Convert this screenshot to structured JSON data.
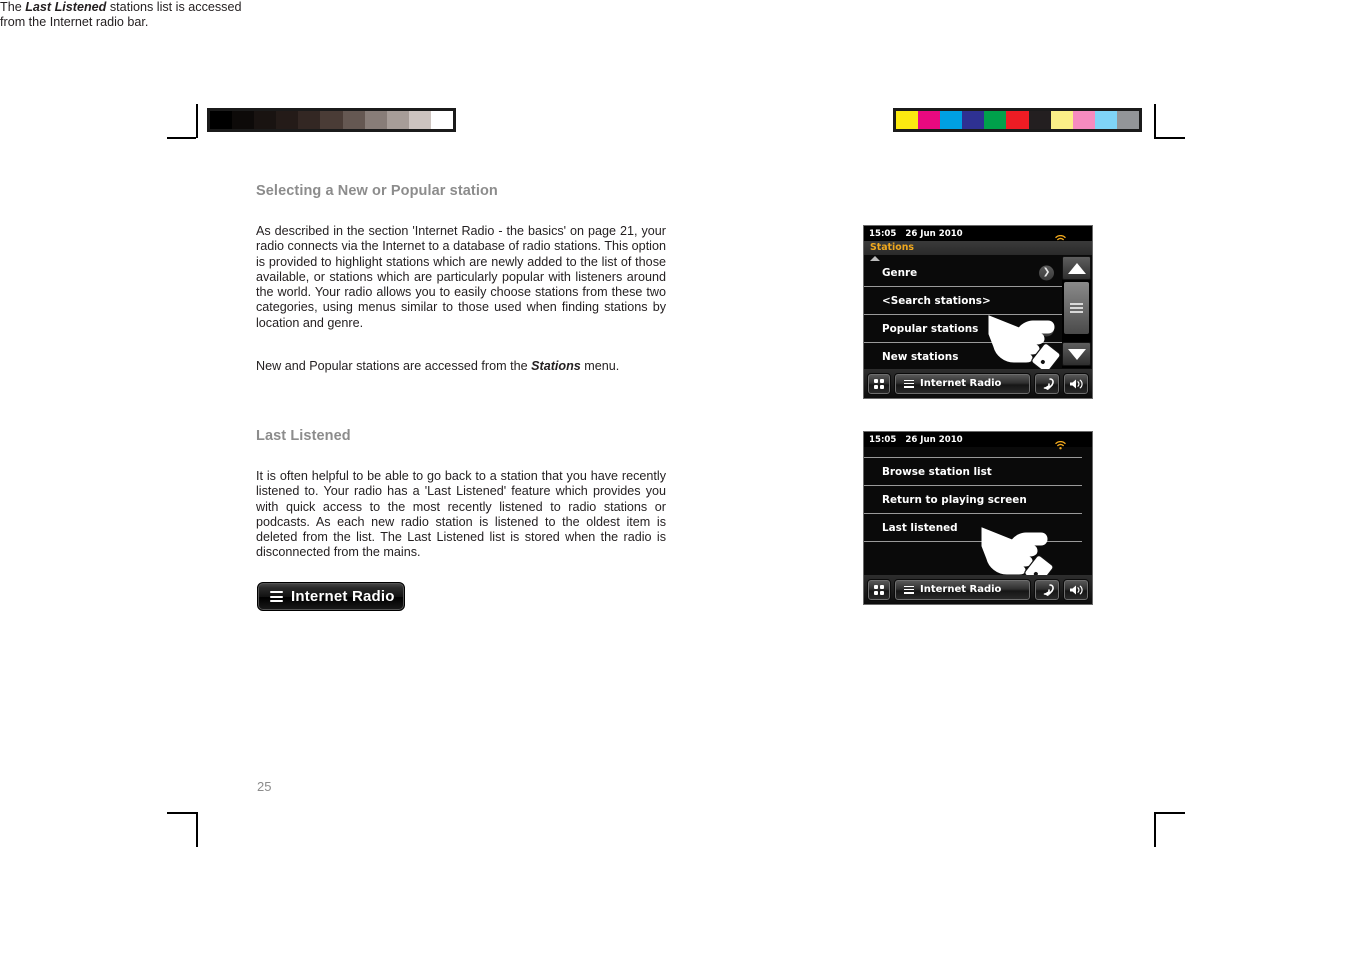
{
  "page": {
    "number": "25"
  },
  "calibration": {
    "gray_label": "grayscale-calibration-strip",
    "gray_swatches": [
      "#000000",
      "#0d0a09",
      "#191311",
      "#241b18",
      "#332723",
      "#4a3c36",
      "#655852",
      "#887d78",
      "#a79d98",
      "#cdc4c0",
      "#ffffff"
    ],
    "color_label": "color-calibration-strip",
    "color_swatches": [
      "#fcea10",
      "#e9097f",
      "#00a0e2",
      "#2e3192",
      "#00a14b",
      "#ed1c24",
      "#231f20",
      "#fbef87",
      "#f68bbf",
      "#7fd4f7",
      "#939598"
    ]
  },
  "sections": [
    {
      "heading": "Selecting a New or Popular station",
      "paragraphs": [
        "As described in the section 'Internet Radio - the basics' on page 21, your radio connects via the Internet to a database of radio stations.  This option is provided to highlight stations which are newly added to the list of those available, or stations which are particularly popular with listeners around the world.  Your radio allows you to easily choose stations from these two categories, using menus similar to those used when finding stations by location and genre."
      ],
      "note_prefix": "New and Popular stations are accessed from the ",
      "note_bold": "Stations",
      "note_suffix": " menu."
    },
    {
      "heading": "Last Listened",
      "paragraphs": [
        "It is often helpful to be able to go back to a station that you have recently listened to. Your radio has a 'Last Listened' feature which provides you with quick access to the most recently listened to radio stations or podcasts. As each new radio station is listened to the oldest item is deleted from the list. The Last Listened list is stored when the radio is disconnected from the mains."
      ]
    }
  ],
  "ir_pill": {
    "label": "Internet Radio",
    "icon": "hamburger-icon"
  },
  "caption": {
    "prefix": "The ",
    "bold": "Last Listened",
    "suffix": " stations list is accessed from the Internet radio bar."
  },
  "device_screens": [
    {
      "name": "stations-menu-screen",
      "status": {
        "time": "15:05",
        "date": "26 Jun 2010",
        "wifi_icon": "wifi-icon"
      },
      "title": "Stations",
      "title_color": "#f0a81e",
      "menu_items": [
        {
          "label": "Genre",
          "chevron": true
        },
        {
          "label": "<Search stations>",
          "chevron": false
        },
        {
          "label": "Popular stations",
          "chevron": true
        },
        {
          "label": "New stations",
          "chevron": true
        }
      ],
      "scrollbar": {
        "up_icon": "scroll-up-arrow-icon",
        "down_icon": "scroll-down-arrow-icon",
        "thumb_icon": "scroll-thumb-grip-icon"
      },
      "bottom_bar": {
        "grid_icon": "grid-menu-icon",
        "mode_label": "Internet Radio",
        "mode_icon": "hamburger-icon",
        "back_icon": "back-arrow-icon",
        "volume_icon": "speaker-volume-icon"
      },
      "pointer": {
        "icon": "pointing-hand-cursor",
        "targets": "Popular stations"
      }
    },
    {
      "name": "internet-radio-bar-menu-screen",
      "status": {
        "time": "15:05",
        "date": "26 Jun 2010",
        "wifi_icon": "wifi-icon"
      },
      "title": "",
      "menu_items": [
        {
          "label": "Browse station list",
          "chevron": false
        },
        {
          "label": "Return to playing screen",
          "chevron": false
        },
        {
          "label": "Last listened",
          "chevron": false
        }
      ],
      "bottom_bar": {
        "grid_icon": "grid-menu-icon",
        "mode_label": "Internet Radio",
        "mode_icon": "hamburger-icon",
        "back_icon": "back-arrow-icon",
        "volume_icon": "speaker-volume-icon"
      },
      "pointer": {
        "icon": "pointing-hand-cursor",
        "targets": "Last listened"
      }
    }
  ]
}
